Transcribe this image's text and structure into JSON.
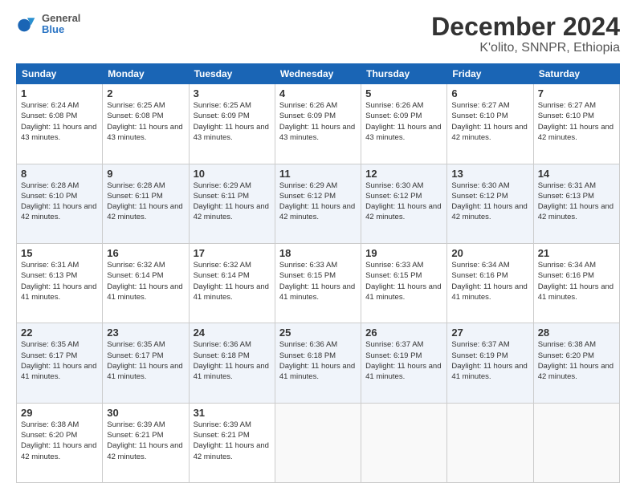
{
  "logo": {
    "line1": "General",
    "line2": "Blue"
  },
  "title": "December 2024",
  "subtitle": "K'olito, SNNPR, Ethiopia",
  "days_of_week": [
    "Sunday",
    "Monday",
    "Tuesday",
    "Wednesday",
    "Thursday",
    "Friday",
    "Saturday"
  ],
  "weeks": [
    [
      {
        "day": "1",
        "sunrise": "6:24 AM",
        "sunset": "6:08 PM",
        "daylight": "11 hours and 43 minutes."
      },
      {
        "day": "2",
        "sunrise": "6:25 AM",
        "sunset": "6:08 PM",
        "daylight": "11 hours and 43 minutes."
      },
      {
        "day": "3",
        "sunrise": "6:25 AM",
        "sunset": "6:09 PM",
        "daylight": "11 hours and 43 minutes."
      },
      {
        "day": "4",
        "sunrise": "6:26 AM",
        "sunset": "6:09 PM",
        "daylight": "11 hours and 43 minutes."
      },
      {
        "day": "5",
        "sunrise": "6:26 AM",
        "sunset": "6:09 PM",
        "daylight": "11 hours and 43 minutes."
      },
      {
        "day": "6",
        "sunrise": "6:27 AM",
        "sunset": "6:10 PM",
        "daylight": "11 hours and 42 minutes."
      },
      {
        "day": "7",
        "sunrise": "6:27 AM",
        "sunset": "6:10 PM",
        "daylight": "11 hours and 42 minutes."
      }
    ],
    [
      {
        "day": "8",
        "sunrise": "6:28 AM",
        "sunset": "6:10 PM",
        "daylight": "11 hours and 42 minutes."
      },
      {
        "day": "9",
        "sunrise": "6:28 AM",
        "sunset": "6:11 PM",
        "daylight": "11 hours and 42 minutes."
      },
      {
        "day": "10",
        "sunrise": "6:29 AM",
        "sunset": "6:11 PM",
        "daylight": "11 hours and 42 minutes."
      },
      {
        "day": "11",
        "sunrise": "6:29 AM",
        "sunset": "6:12 PM",
        "daylight": "11 hours and 42 minutes."
      },
      {
        "day": "12",
        "sunrise": "6:30 AM",
        "sunset": "6:12 PM",
        "daylight": "11 hours and 42 minutes."
      },
      {
        "day": "13",
        "sunrise": "6:30 AM",
        "sunset": "6:12 PM",
        "daylight": "11 hours and 42 minutes."
      },
      {
        "day": "14",
        "sunrise": "6:31 AM",
        "sunset": "6:13 PM",
        "daylight": "11 hours and 42 minutes."
      }
    ],
    [
      {
        "day": "15",
        "sunrise": "6:31 AM",
        "sunset": "6:13 PM",
        "daylight": "11 hours and 41 minutes."
      },
      {
        "day": "16",
        "sunrise": "6:32 AM",
        "sunset": "6:14 PM",
        "daylight": "11 hours and 41 minutes."
      },
      {
        "day": "17",
        "sunrise": "6:32 AM",
        "sunset": "6:14 PM",
        "daylight": "11 hours and 41 minutes."
      },
      {
        "day": "18",
        "sunrise": "6:33 AM",
        "sunset": "6:15 PM",
        "daylight": "11 hours and 41 minutes."
      },
      {
        "day": "19",
        "sunrise": "6:33 AM",
        "sunset": "6:15 PM",
        "daylight": "11 hours and 41 minutes."
      },
      {
        "day": "20",
        "sunrise": "6:34 AM",
        "sunset": "6:16 PM",
        "daylight": "11 hours and 41 minutes."
      },
      {
        "day": "21",
        "sunrise": "6:34 AM",
        "sunset": "6:16 PM",
        "daylight": "11 hours and 41 minutes."
      }
    ],
    [
      {
        "day": "22",
        "sunrise": "6:35 AM",
        "sunset": "6:17 PM",
        "daylight": "11 hours and 41 minutes."
      },
      {
        "day": "23",
        "sunrise": "6:35 AM",
        "sunset": "6:17 PM",
        "daylight": "11 hours and 41 minutes."
      },
      {
        "day": "24",
        "sunrise": "6:36 AM",
        "sunset": "6:18 PM",
        "daylight": "11 hours and 41 minutes."
      },
      {
        "day": "25",
        "sunrise": "6:36 AM",
        "sunset": "6:18 PM",
        "daylight": "11 hours and 41 minutes."
      },
      {
        "day": "26",
        "sunrise": "6:37 AM",
        "sunset": "6:19 PM",
        "daylight": "11 hours and 41 minutes."
      },
      {
        "day": "27",
        "sunrise": "6:37 AM",
        "sunset": "6:19 PM",
        "daylight": "11 hours and 41 minutes."
      },
      {
        "day": "28",
        "sunrise": "6:38 AM",
        "sunset": "6:20 PM",
        "daylight": "11 hours and 42 minutes."
      }
    ],
    [
      {
        "day": "29",
        "sunrise": "6:38 AM",
        "sunset": "6:20 PM",
        "daylight": "11 hours and 42 minutes."
      },
      {
        "day": "30",
        "sunrise": "6:39 AM",
        "sunset": "6:21 PM",
        "daylight": "11 hours and 42 minutes."
      },
      {
        "day": "31",
        "sunrise": "6:39 AM",
        "sunset": "6:21 PM",
        "daylight": "11 hours and 42 minutes."
      },
      null,
      null,
      null,
      null
    ]
  ],
  "labels": {
    "sunrise": "Sunrise:",
    "sunset": "Sunset:",
    "daylight": "Daylight:"
  }
}
